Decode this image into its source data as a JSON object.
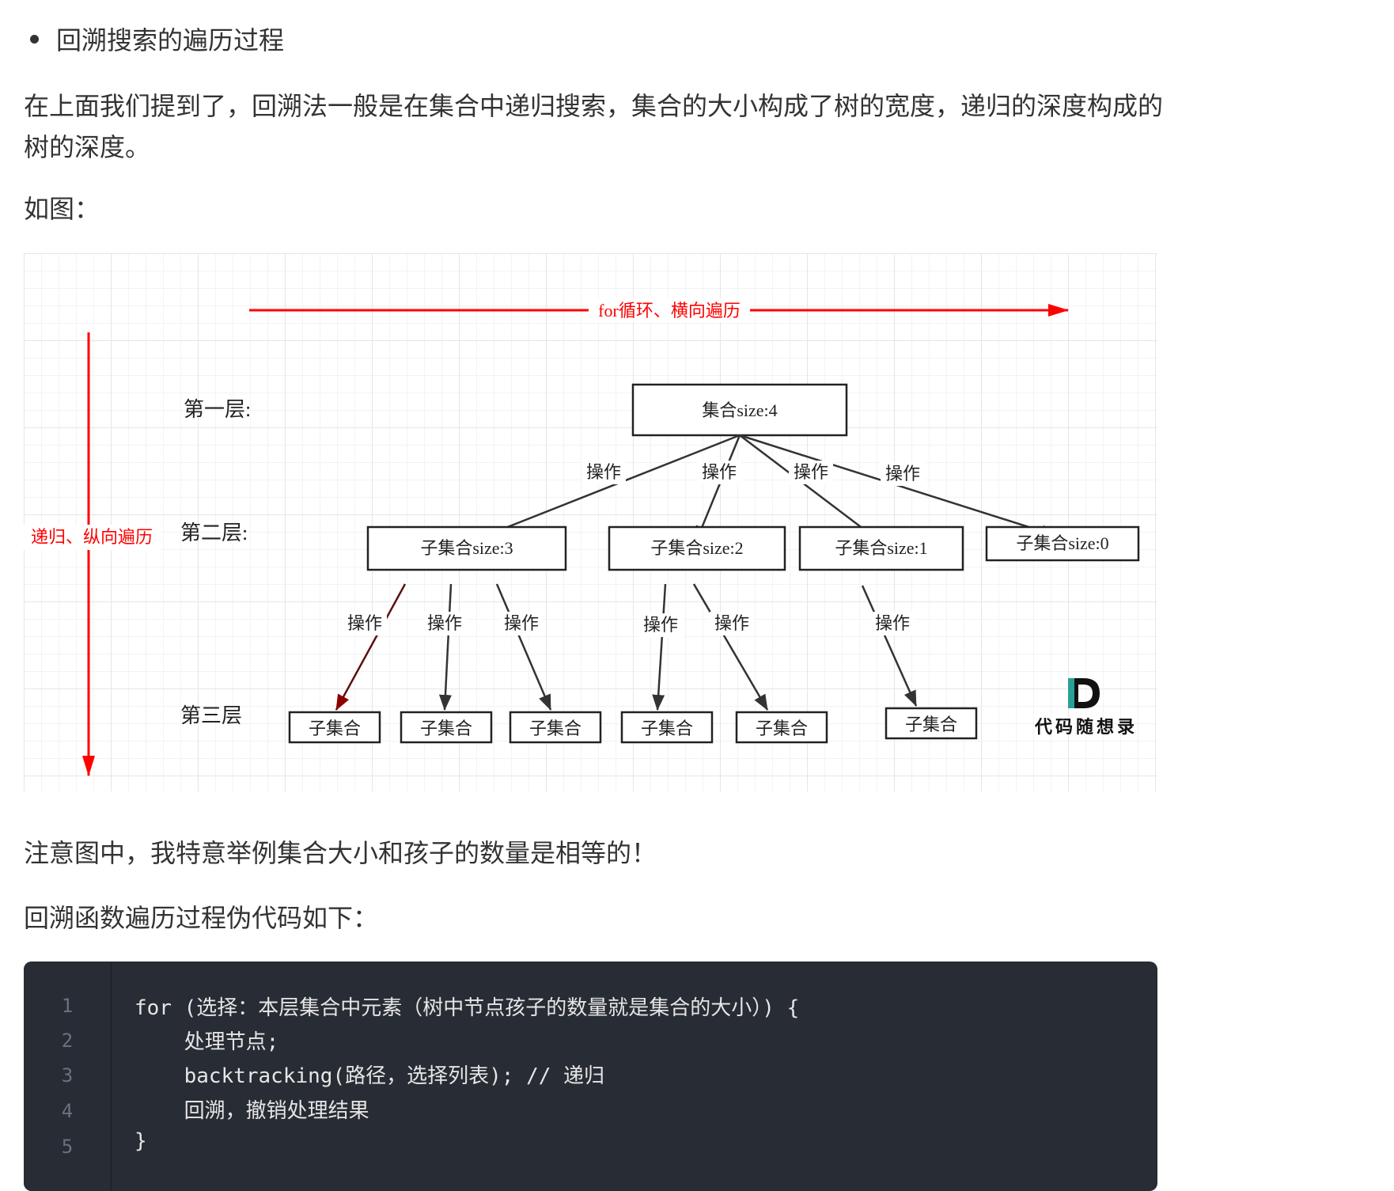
{
  "heading": "回溯搜索的遍历过程",
  "paragraph1": "在上面我们提到了，回溯法一般是在集合中递归搜索，集合的大小构成了树的宽度，递归的深度构成的树的深度。",
  "paragraph2": "如图：",
  "diagram": {
    "horizontal_label": "for循环、横向遍历",
    "vertical_label": "递归、纵向遍历",
    "level1_label": "第一层:",
    "level2_label": "第二层:",
    "level3_label": "第三层",
    "root": "集合size:4",
    "level2_nodes": [
      "子集合size:3",
      "子集合size:2",
      "子集合size:1",
      "子集合size:0"
    ],
    "level3_nodes": [
      "子集合",
      "子集合",
      "子集合",
      "子集合",
      "子集合",
      "子集合"
    ],
    "edge_label": "操作",
    "watermark": "代码随想录",
    "colors": {
      "accent": "#ff0000",
      "box": "#222222",
      "watermark_teal": "#2aa198"
    }
  },
  "paragraph3": "注意图中，我特意举例集合大小和孩子的数量是相等的！",
  "paragraph4": "回溯函数遍历过程伪代码如下：",
  "code": {
    "line_numbers": [
      "1",
      "2",
      "3",
      "4",
      "5"
    ],
    "lines": [
      "for (选择：本层集合中元素（树中节点孩子的数量就是集合的大小）) {",
      "    处理节点;",
      "    backtracking(路径，选择列表); // 递归",
      "    回溯，撤销处理结果",
      "}"
    ]
  }
}
